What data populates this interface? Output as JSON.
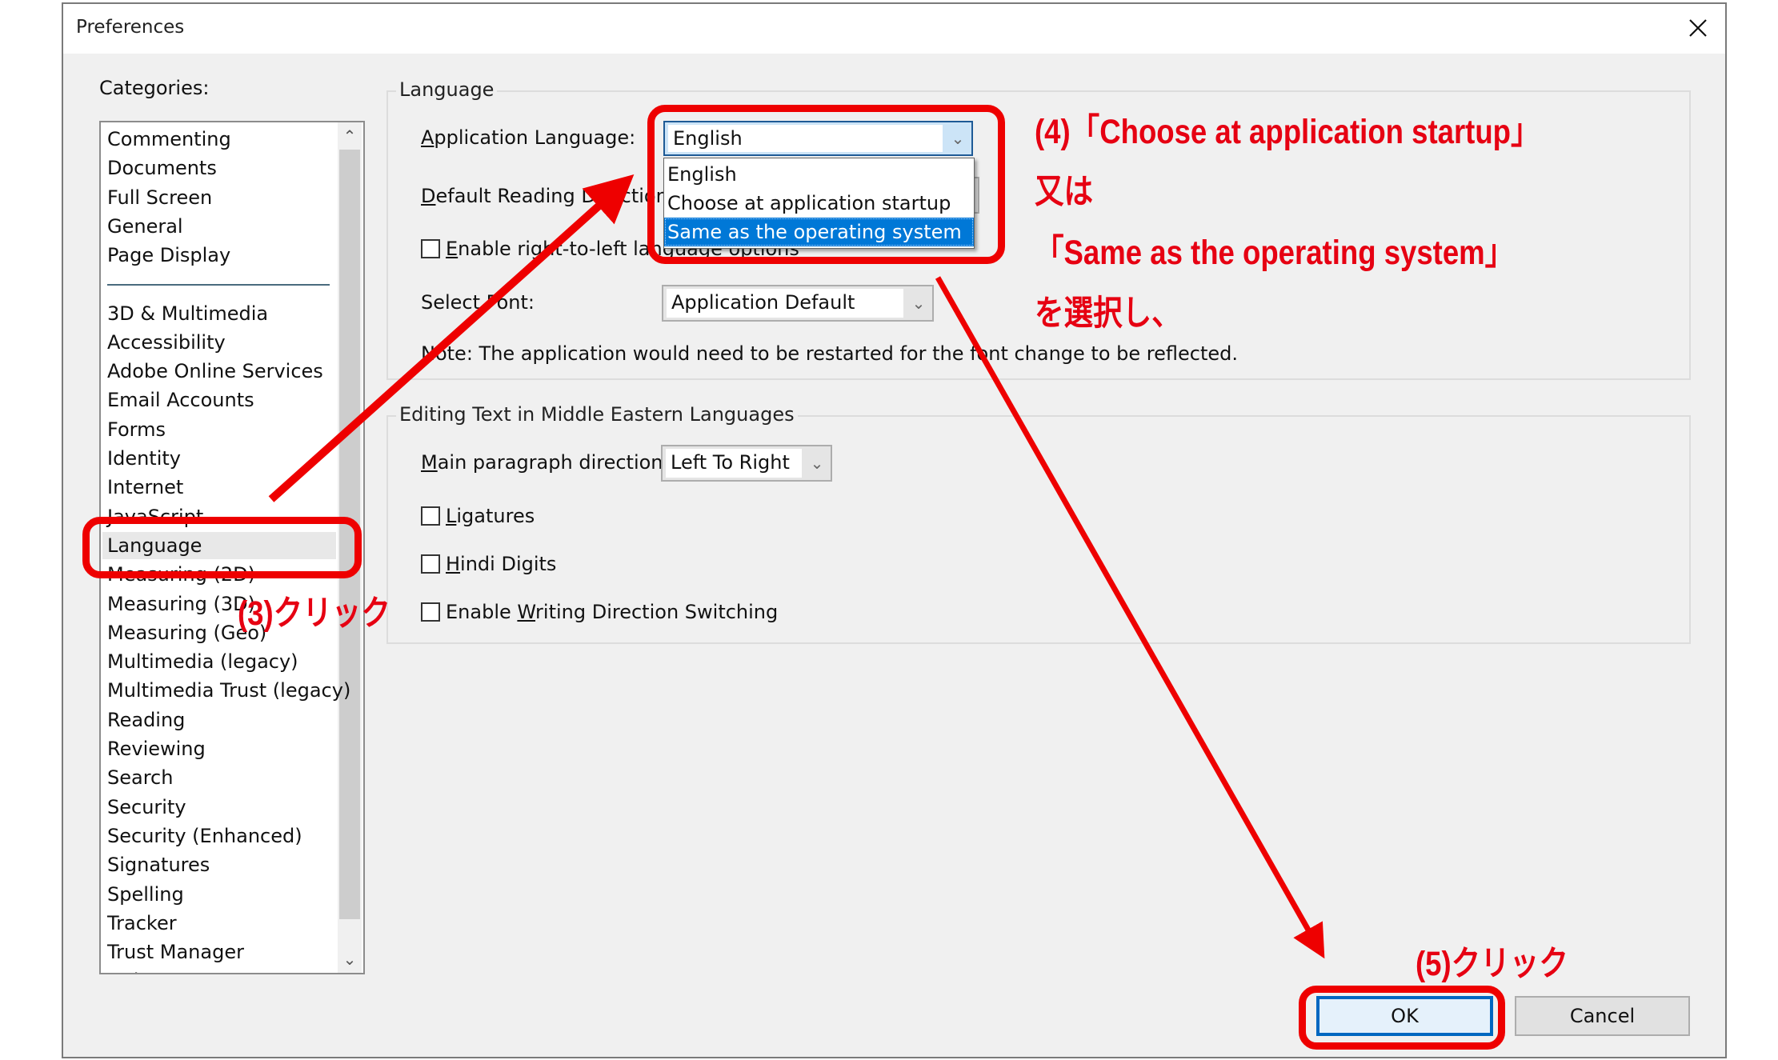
{
  "dialog": {
    "title": "Preferences",
    "close_label": "Close"
  },
  "categories": {
    "label": "Categories:",
    "group1": [
      "Commenting",
      "Documents",
      "Full Screen",
      "General",
      "Page Display"
    ],
    "group2": [
      "3D & Multimedia",
      "Accessibility",
      "Adobe Online Services",
      "Email Accounts",
      "Forms",
      "Identity",
      "Internet",
      "JavaScript",
      "Language",
      "Measuring (2D)",
      "Measuring (3D)",
      "Measuring (Geo)",
      "Multimedia (legacy)",
      "Multimedia Trust (legacy)",
      "Reading",
      "Reviewing",
      "Search",
      "Security",
      "Security (Enhanced)",
      "Signatures",
      "Spelling",
      "Tracker",
      "Trust Manager",
      "Units"
    ],
    "selected": "Language"
  },
  "language_group": {
    "title": "Language",
    "app_language_label": "Application Language:",
    "app_language_value": "English",
    "app_language_options": [
      "English",
      "Choose at application startup",
      "Same as the operating system"
    ],
    "app_language_highlighted": "Same as the operating system",
    "reading_direction_label": "Default Reading Direction:",
    "rtl_checkbox_label": "Enable right-to-left language options",
    "rtl_checked": false,
    "select_font_label": "Select Font:",
    "select_font_value": "Application Default",
    "note": "Note: The application would need to be restarted for the font change to be reflected."
  },
  "middle_eastern_group": {
    "title": "Editing Text in Middle Eastern Languages",
    "paragraph_direction_label": "Main paragraph direction:",
    "paragraph_direction_value": "Left To Right",
    "ligatures_label": "Ligatures",
    "ligatures_checked": false,
    "hindi_digits_label": "Hindi Digits",
    "hindi_digits_checked": false,
    "writing_direction_label": "Enable Writing Direction Switching",
    "writing_direction_checked": false
  },
  "buttons": {
    "ok": "OK",
    "cancel": "Cancel"
  },
  "annotations": {
    "step3": "(3)クリック",
    "step4_line1": "(4)「Choose at application startup」",
    "step4_line2": "又は",
    "step4_line3": "「Same as the operating system」",
    "step4_line4": "を選択し、",
    "step5": "(5)クリック",
    "color": "#e60012"
  }
}
